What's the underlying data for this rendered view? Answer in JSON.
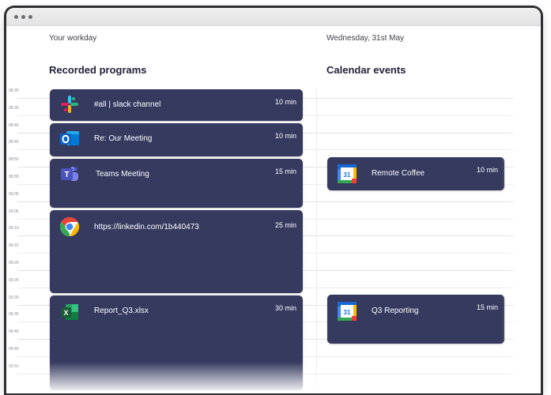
{
  "header": {
    "left_label": "Your workday",
    "date": "Wednesday, 31st May"
  },
  "sections": {
    "recorded_title": "Recorded programs",
    "calendar_title": "Calendar events"
  },
  "timeline": {
    "labels": [
      "08:30",
      "08:35",
      "08:40",
      "08:45",
      "08:50",
      "08:55",
      "09:00",
      "09:05",
      "09:10",
      "09:15",
      "09:20",
      "09:25",
      "09:30",
      "09:35",
      "09:40",
      "09:45",
      "09:50"
    ]
  },
  "recorded": [
    {
      "title": "#all | slack channel",
      "duration": "10 min",
      "icon": "slack-icon"
    },
    {
      "title": "Re: Our Meeting",
      "duration": "10 min",
      "icon": "outlook-icon"
    },
    {
      "title": "Teams Meeting",
      "duration": "15 min",
      "icon": "teams-icon"
    },
    {
      "title": "https://linkedin.com/1b440473",
      "duration": "25 min",
      "icon": "chrome-icon"
    },
    {
      "title": "Report_Q3.xlsx",
      "duration": "30 min",
      "icon": "excel-icon"
    }
  ],
  "calendar": [
    {
      "title": "Remote Coffee",
      "duration": "10 min",
      "icon": "google-calendar-icon",
      "icon_text": "31"
    },
    {
      "title": "Q3 Reporting",
      "duration": "15 min",
      "icon": "google-calendar-icon",
      "icon_text": "31"
    }
  ],
  "colors": {
    "event_bg": "#363a5f",
    "text_dark": "#23233b"
  }
}
